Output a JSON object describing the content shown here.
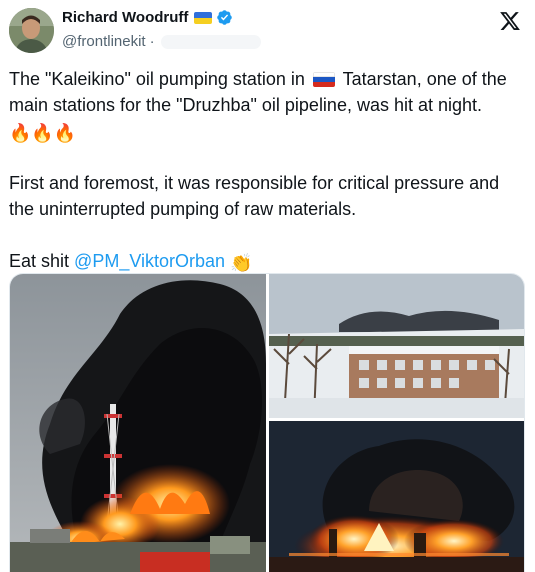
{
  "author": {
    "display_name": "Richard Woodruff",
    "handle": "@frontlinekit",
    "separator": "·"
  },
  "tweet": {
    "line1_before_flag": "The \"Kaleikino\" oil pumping station in",
    "line1_after_flag": "Tatarstan, one of the main stations for the \"Druzhba\" oil pipeline, was hit at night.",
    "fire_emojis": "🔥🔥🔥",
    "paragraph2": "First and foremost, it was responsible for critical pressure and the uninterrupted pumping of raw materials.",
    "paragraph3_prefix": "Eat shit",
    "mention": "@PM_ViktorOrban",
    "clap_emoji": "👏"
  },
  "icons": {
    "verified": "verified-badge-icon",
    "x_logo": "x-logo-icon",
    "flag_ua": "ukraine-flag-icon",
    "flag_ru": "russia-flag-icon"
  },
  "colors": {
    "text": "#0f1419",
    "secondary": "#536471",
    "link": "#1d9bf0",
    "verified": "#1d9bf0"
  }
}
